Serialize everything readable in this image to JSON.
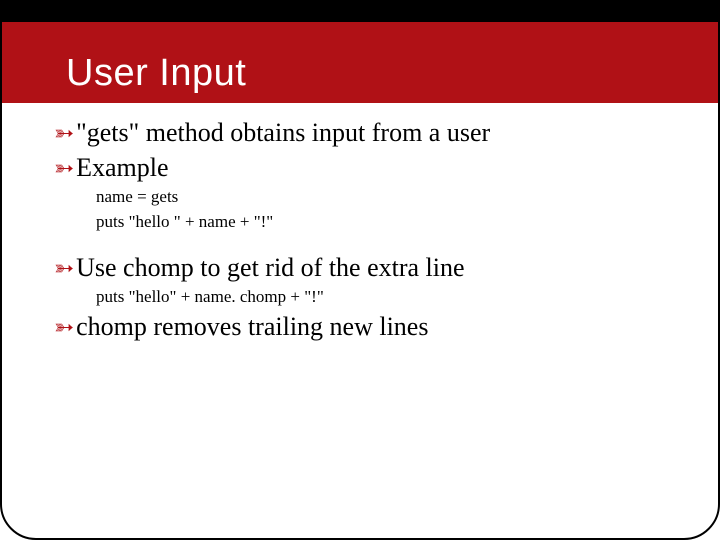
{
  "slide": {
    "title": "User Input",
    "bullets": [
      {
        "text": "\"gets\" method obtains input from a user"
      },
      {
        "text": "Example"
      }
    ],
    "code1_line1": "name = gets",
    "code1_line2": "puts \"hello \" + name + \"!\"",
    "bullet3": "Use chomp to get rid of the extra line",
    "code2_line1": "puts \"hello\" + name. chomp + \"!\"",
    "bullet4": "chomp removes trailing new lines"
  }
}
